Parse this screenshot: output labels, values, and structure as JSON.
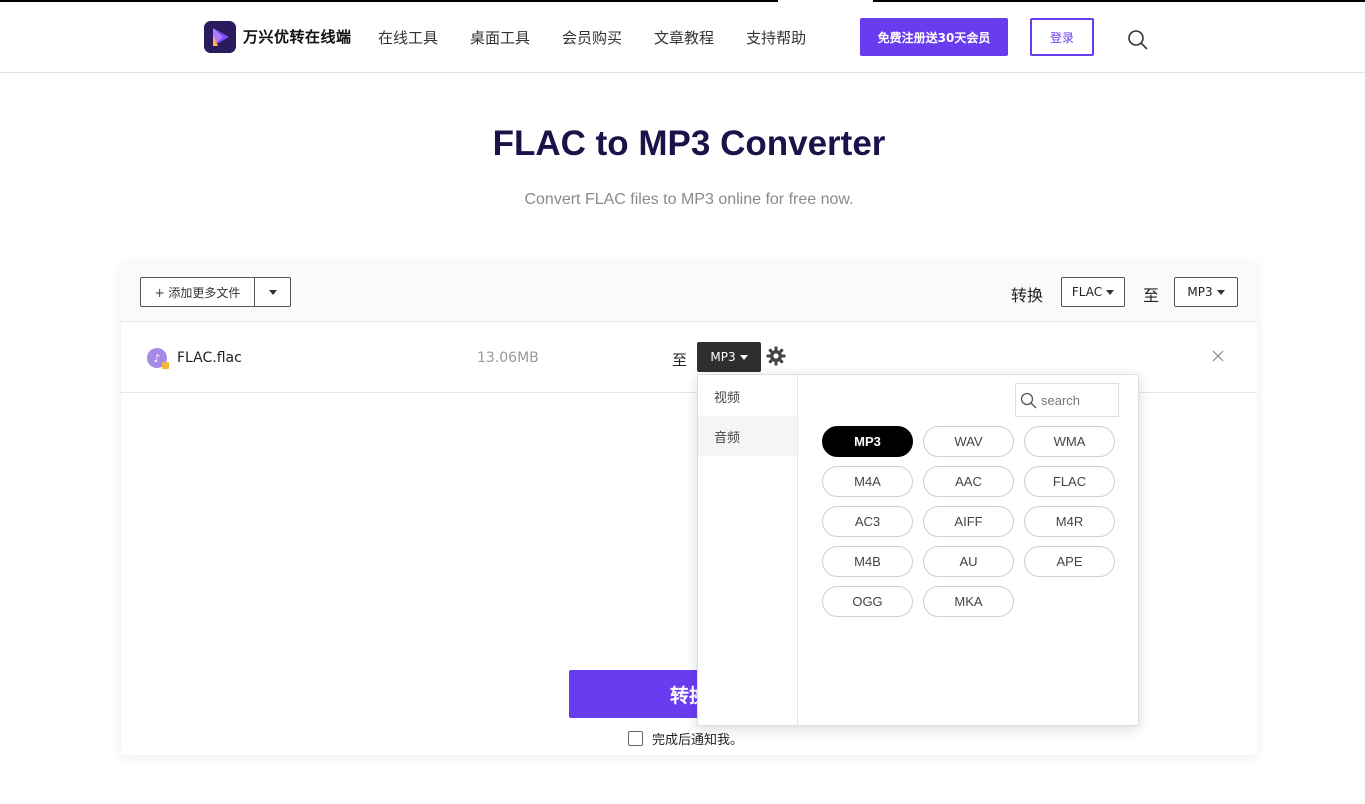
{
  "header": {
    "brand": "万兴优转在线端",
    "nav": [
      "在线工具",
      "桌面工具",
      "会员购买",
      "文章教程",
      "支持帮助"
    ],
    "register_label": "免费注册送30天会员",
    "login_label": "登录"
  },
  "hero": {
    "title": "FLAC to MP3 Converter",
    "subtitle": "Convert FLAC files to MP3 online for free now."
  },
  "toolbar": {
    "add_files_label": "+ 添加更多文件",
    "convert_label": "转换",
    "from_format": "FLAC",
    "to_label": "至",
    "to_format": "MP3"
  },
  "file": {
    "name": "FLAC.flac",
    "size": "13.06MB",
    "to_label": "至",
    "format": "MP3"
  },
  "dropdown": {
    "categories": [
      "视频",
      "音频"
    ],
    "active_category": "音频",
    "search_placeholder": "search",
    "formats": [
      "MP3",
      "WAV",
      "WMA",
      "M4A",
      "AAC",
      "FLAC",
      "AC3",
      "AIFF",
      "M4R",
      "M4B",
      "AU",
      "APE",
      "OGG",
      "MKA"
    ],
    "selected_format": "MP3"
  },
  "actions": {
    "convert_button": "转换",
    "notify_label": "完成后通知我。"
  },
  "colors": {
    "accent": "#6a3cf0",
    "title": "#1a1248",
    "selected_pill": "#000000"
  }
}
